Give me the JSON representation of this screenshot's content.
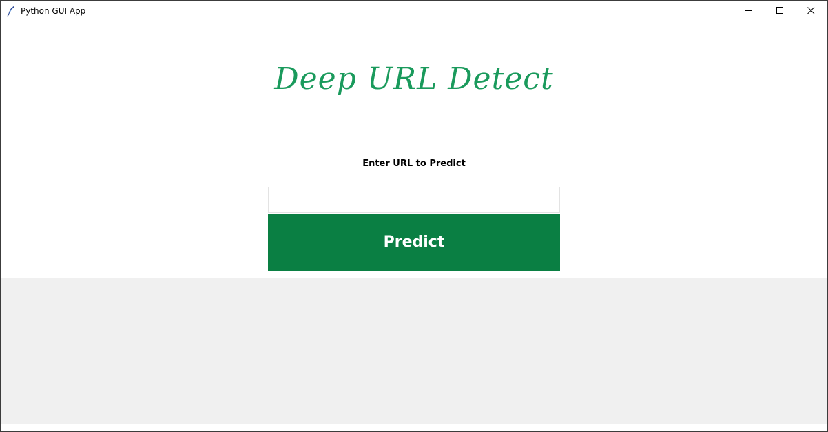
{
  "window": {
    "title": "Python GUI App",
    "app_icon": "feather-icon",
    "controls": {
      "minimize_icon": "minimize-icon",
      "maximize_icon": "maximize-icon",
      "close_icon": "close-icon"
    }
  },
  "main": {
    "heading": "Deep URL Detect",
    "url_label": "Enter URL to Predict",
    "url_input_value": "",
    "predict_label": "Predict"
  },
  "colors": {
    "heading": "#1a9a5c",
    "predict_button_bg": "#0a7f43",
    "predict_button_text": "#ffffff",
    "lower_panel_bg": "#f0f0f0"
  }
}
